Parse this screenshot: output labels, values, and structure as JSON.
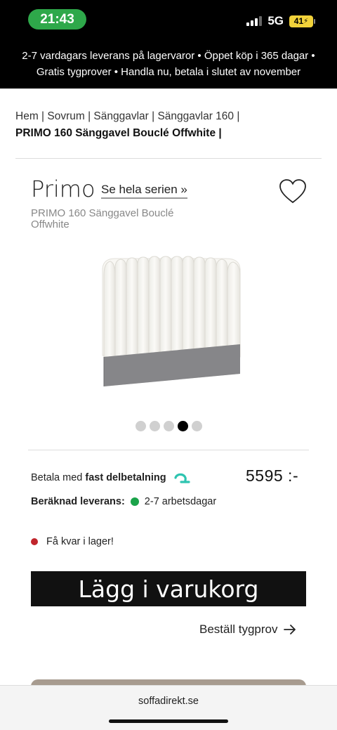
{
  "status_bar": {
    "time": "21:43",
    "network": "5G",
    "battery": "41"
  },
  "announcement": {
    "line1": "2-7 vardagars leverans på lagervaror  •  Öppet köp i 365 dagar  •",
    "line2": "Gratis tygprover  •  Handla nu, betala i slutet av november"
  },
  "breadcrumb": {
    "path": "Hem | Sovrum | Sänggavlar | Sänggavlar 160 |",
    "current": "PRIMO 160 Sänggavel Bouclé Offwhite |"
  },
  "product": {
    "brand": "Primo",
    "series_link": "Se hela serien »",
    "subtitle": "PRIMO 160 Sänggavel Bouclé Offwhite",
    "image_alt": "Sänggavel"
  },
  "carousel": {
    "count": 5,
    "active_index": 3
  },
  "payment": {
    "prefix": "Betala med ",
    "method": "fast delbetalning",
    "price": "5595 :-"
  },
  "delivery": {
    "label": "Beräknad leverans:",
    "value": "2-7 arbetsdagar"
  },
  "stock": {
    "text": "Få kvar i lager!"
  },
  "cta": {
    "label": "Lägg i varukorg"
  },
  "order_sample": {
    "label": "Beställ tygprov"
  },
  "browser": {
    "url": "soffadirekt.se"
  },
  "colors": {
    "accent_green": "#2ea84a",
    "klarna_teal": "#2ec4b0",
    "stock_red": "#c0252c",
    "delivery_green": "#1aa34a"
  }
}
